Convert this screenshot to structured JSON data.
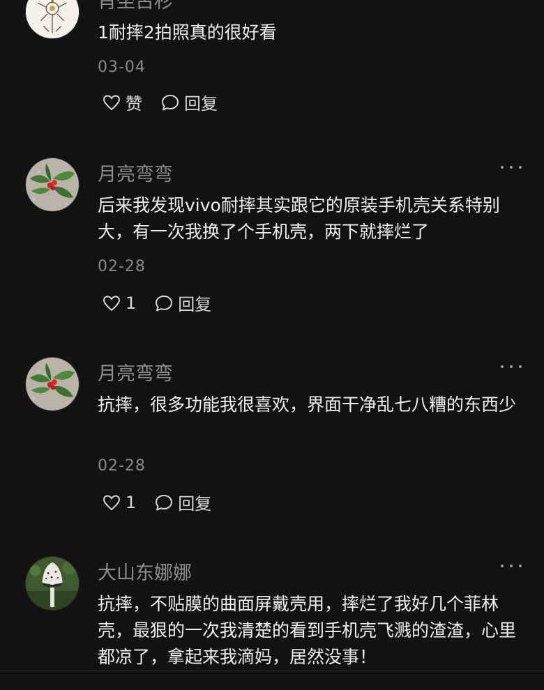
{
  "comments": [
    {
      "user": "肖坐古杉",
      "text": "1耐摔2拍照真的很好看",
      "date": "03-04",
      "like_label": "赞",
      "reply_label": "回复",
      "avatar_icon": "sketch-flower-avatar"
    },
    {
      "user": "月亮弯弯",
      "text": "后来我发现vivo耐摔其实跟它的原装手机壳关系特别大，有一次我换了个手机壳，两下就摔烂了",
      "date": "02-28",
      "like_label": "1",
      "reply_label": "回复",
      "avatar_icon": "holly-berries-avatar"
    },
    {
      "user": "月亮弯弯",
      "text": "抗摔，很多功能我很喜欢，界面干净乱七八糟的东西少",
      "date": "02-28",
      "like_label": "1",
      "reply_label": "回复",
      "avatar_icon": "holly-berries-avatar"
    },
    {
      "user": "大山东娜娜",
      "text": "抗摔，不贴膜的曲面屏戴壳用，摔烂了我好几个菲林壳，最狠的一次我清楚的看到手机壳飞溅的渣渣，心里都凉了，拿起来我滴妈，居然没事！",
      "date": "",
      "like_label": "",
      "reply_label": "",
      "avatar_icon": "mushroom-avatar"
    }
  ],
  "colors": {
    "background": "#121212",
    "username": "#8f8f8f",
    "text": "#f0f0f0",
    "date": "#8a8a8a"
  }
}
